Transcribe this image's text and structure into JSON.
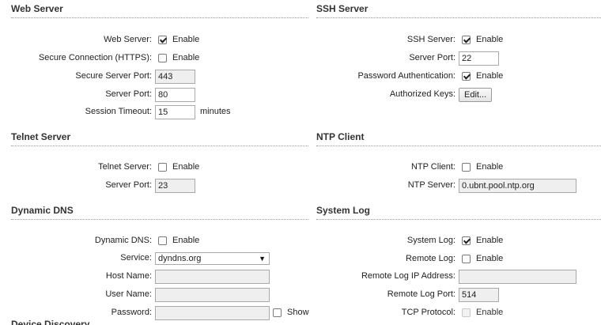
{
  "web_server": {
    "title": "Web Server",
    "web_server_label": "Web Server:",
    "web_server_enable": "Enable",
    "https_label": "Secure Connection (HTTPS):",
    "https_enable": "Enable",
    "secure_port_label": "Secure Server Port:",
    "secure_port_value": "443",
    "server_port_label": "Server Port:",
    "server_port_value": "80",
    "session_timeout_label": "Session Timeout:",
    "session_timeout_value": "15",
    "session_timeout_unit": "minutes"
  },
  "ssh_server": {
    "title": "SSH Server",
    "ssh_label": "SSH Server:",
    "ssh_enable": "Enable",
    "port_label": "Server Port:",
    "port_value": "22",
    "password_auth_label": "Password Authentication:",
    "password_auth_enable": "Enable",
    "authorized_keys_label": "Authorized Keys:",
    "edit_button": "Edit..."
  },
  "telnet_server": {
    "title": "Telnet Server",
    "telnet_label": "Telnet Server:",
    "telnet_enable": "Enable",
    "port_label": "Server Port:",
    "port_value": "23"
  },
  "ntp_client": {
    "title": "NTP Client",
    "ntp_label": "NTP Client:",
    "ntp_enable": "Enable",
    "server_label": "NTP Server:",
    "server_value": "0.ubnt.pool.ntp.org"
  },
  "dynamic_dns": {
    "title": "Dynamic DNS",
    "ddns_label": "Dynamic DNS:",
    "ddns_enable": "Enable",
    "service_label": "Service:",
    "service_value": "dyndns.org",
    "host_label": "Host Name:",
    "user_label": "User Name:",
    "password_label": "Password:",
    "show_label": "Show"
  },
  "system_log": {
    "title": "System Log",
    "syslog_label": "System Log:",
    "syslog_enable": "Enable",
    "remote_log_label": "Remote Log:",
    "remote_log_enable": "Enable",
    "remote_ip_label": "Remote Log IP Address:",
    "remote_port_label": "Remote Log Port:",
    "remote_port_value": "514",
    "tcp_label": "TCP Protocol:",
    "tcp_enable": "Enable"
  },
  "device_discovery": {
    "title": "Device Discovery"
  }
}
